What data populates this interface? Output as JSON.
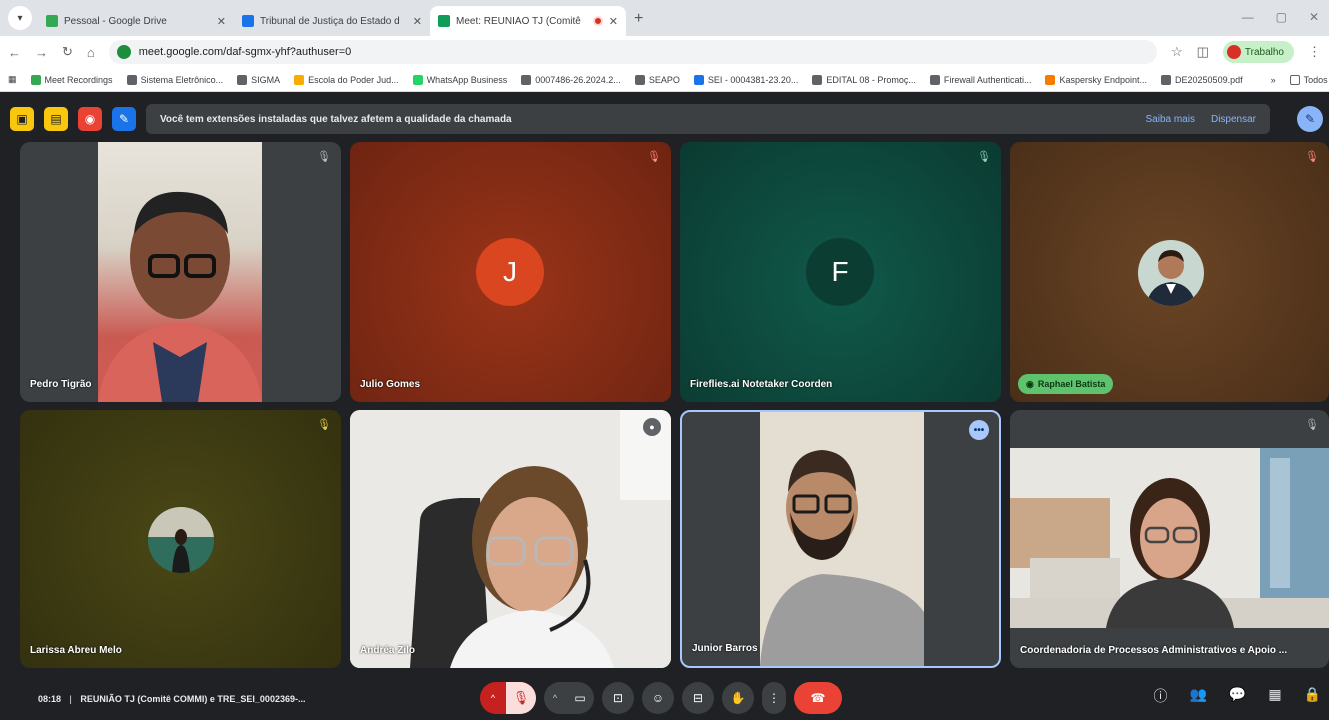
{
  "browser": {
    "tabs": [
      {
        "title": "Pessoal - Google Drive",
        "color": "#34a853"
      },
      {
        "title": "Tribunal de Justiça do Estado d",
        "color": "#1a73e8"
      },
      {
        "title": "Meet: REUNIÃO TJ (Comitê",
        "color": "#0f9d58",
        "active": true
      }
    ],
    "url": "meet.google.com/daf-sgmx-yhf?authuser=0",
    "profile_label": "Trabalho",
    "bookmarks": [
      "Meet Recordings",
      "Sistema Eletrônico...",
      "SIGMA",
      "Escola do Poder Jud...",
      "WhatsApp Business",
      "0007486-26.2024.2...",
      "SEAPO",
      "SEI - 0004381-23.20...",
      "EDITAL 08 - Promoç...",
      "Firewall Authenticati...",
      "Kaspersky Endpoint...",
      "DE20250509.pdf"
    ],
    "bookmarks_more": "»",
    "all_favorites": "Todos os favoritos"
  },
  "notice": {
    "text": "Você tem extensões instaladas que talvez afetem a qualidade da chamada",
    "learn_more": "Saiba mais",
    "dismiss": "Dispensar"
  },
  "participants": [
    {
      "name": "Pedro Tigrão"
    },
    {
      "name": "Julio Gomes",
      "initial": "J",
      "bg": "#8a2a12",
      "avatar_bg": "#d9461f"
    },
    {
      "name": "Fireflies.ai Notetaker Coorden",
      "initial": "F",
      "bg": "#0f4a3e",
      "avatar_bg": "#0d3b31"
    },
    {
      "name": "Raphael Batista",
      "bg": "#5a3a1e"
    },
    {
      "name": "Larissa Abreu Melo",
      "bg": "#3e3c15"
    },
    {
      "name": "Andréa Zilo"
    },
    {
      "name": "Junior Barros"
    },
    {
      "name": "Coordenadoria de Processos Administrativos e Apoio ..."
    }
  ],
  "meeting": {
    "time": "08:18",
    "separator": "|",
    "title": "REUNIÃO TJ (Comitê COMMI) e TRE_SEI_0002369-..."
  },
  "icons": {
    "mic_off": "mic-off-icon",
    "camera": "camera-icon",
    "present": "present-icon",
    "emoji": "emoji-icon",
    "captions": "captions-icon",
    "raise_hand": "hand-icon",
    "more": "more-icon",
    "hangup": "hangup-icon"
  }
}
